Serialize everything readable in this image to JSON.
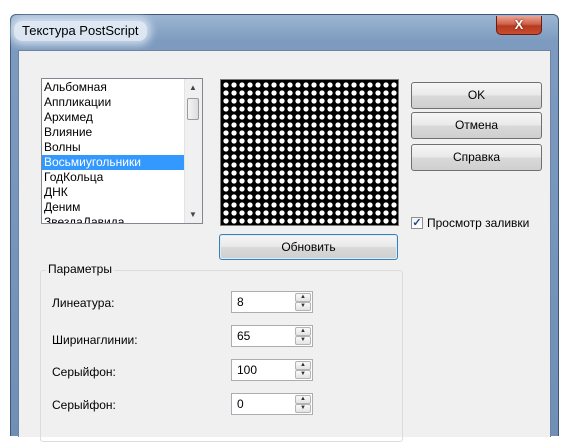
{
  "window": {
    "title": "Текстура PostScript",
    "close_glyph": "X"
  },
  "texture_list": {
    "items": [
      "Альбомная",
      "Аппликации",
      "Архимед",
      "Влияние",
      "Волны",
      "Восьмиугольники",
      "ГодКольца",
      "ДНК",
      "Деним",
      "ЗвездаДавида"
    ],
    "selected": "Восьмиугольники",
    "scroll_up_icon": "scroll-up-arrow-icon",
    "scroll_down_icon": "scroll-down-arrow-icon"
  },
  "preview": {
    "pattern": "white dots on black"
  },
  "buttons": {
    "ok": "OK",
    "cancel": "Отмена",
    "help": "Справка",
    "refresh": "Обновить"
  },
  "preview_fill": {
    "label": "Просмотр заливки",
    "checked": true
  },
  "parameters": {
    "title": "Параметры",
    "fields": [
      {
        "label": "Линеатура:",
        "value": "8"
      },
      {
        "label": "Ширинаглинии:",
        "value": "65"
      },
      {
        "label": "Серыйфон:",
        "value": "100"
      },
      {
        "label": "Серыйфон:",
        "value": "0"
      }
    ]
  },
  "colors": {
    "selection": "#3399ff",
    "close_button": "#c94c2f",
    "frame": "#7d9bbf"
  }
}
